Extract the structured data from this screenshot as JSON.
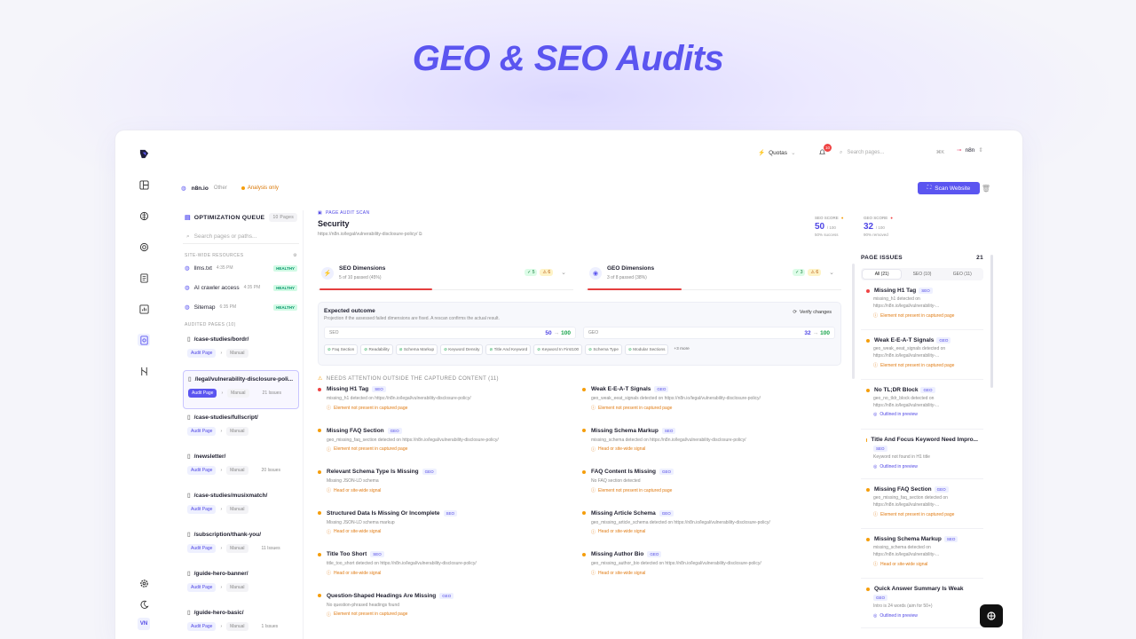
{
  "hero_title": "GEO & SEO Audits",
  "topbar": {
    "quotas": "Quotas",
    "bell_count": "10",
    "search_placeholder": "Search pages...",
    "shortcut": "⌘K",
    "user": "n8n"
  },
  "site": {
    "domain": "n8n.io",
    "category": "Other",
    "mode": "Analysis only",
    "scan_label": "Scan Website"
  },
  "rail_initials": "VN",
  "queue": {
    "title": "OPTIMIZATION QUEUE",
    "count": "10 Pages",
    "search_placeholder": "Search pages or paths...",
    "site_wide_label": "SITE-WIDE RESOURCES",
    "resources": [
      {
        "name": "llms.txt",
        "time": "4:35 PM",
        "status": "HEALTHY"
      },
      {
        "name": "AI crawler access",
        "time": "4:35 PM",
        "status": "HEALTHY"
      },
      {
        "name": "Sitemap",
        "time": "6:35 PM",
        "status": "HEALTHY"
      }
    ],
    "audited_label": "AUDITED PAGES (10)",
    "pages": [
      {
        "path": "/case-studies/bordr/",
        "audit": "Audit Page",
        "manual": "Manual",
        "issues": ""
      },
      {
        "path": "/legal/vulnerability-disclosure-poli...",
        "audit": "Audit Page",
        "manual": "Manual",
        "issues": "21 Issues"
      },
      {
        "path": "/case-studies/fullscript/",
        "audit": "Audit Page",
        "manual": "Manual",
        "issues": ""
      },
      {
        "path": "/newsletter/",
        "audit": "Audit Page",
        "manual": "Manual",
        "issues": "20 Issues"
      },
      {
        "path": "/case-studies/musixmatch/",
        "audit": "Audit Page",
        "manual": "Manual",
        "issues": ""
      },
      {
        "path": "/subscription/thank-you/",
        "audit": "Audit Page",
        "manual": "Manual",
        "issues": "11 Issues"
      },
      {
        "path": "/guide-hero-banner/",
        "audit": "Audit Page",
        "manual": "Manual",
        "issues": ""
      },
      {
        "path": "/guide-hero-basic/",
        "audit": "Audit Page",
        "manual": "Manual",
        "issues": "1 Issues"
      }
    ]
  },
  "audit": {
    "label": "PAGE AUDIT SCAN",
    "title": "Security",
    "url": "https://n8n.io/legal/vulnerability-disclosure-policy/"
  },
  "scores": [
    {
      "label": "SEO SCORE",
      "value": "50",
      "max": "/ 100",
      "sub": "50% success"
    },
    {
      "label": "GEO SCORE",
      "value": "32",
      "max": "/ 100",
      "sub": "90% removed"
    }
  ],
  "dimensions": [
    {
      "name": "SEO Dimensions",
      "passed": "5 of 10 passed (45%)",
      "green": "5",
      "yellow": "6"
    },
    {
      "name": "GEO Dimensions",
      "passed": "3 of 8 passed (38%)",
      "green": "3",
      "yellow": "6"
    }
  ],
  "expected": {
    "title": "Expected outcome",
    "subtitle": "Projection if the assessed failed dimensions are fixed. A rescan confirms the actual result.",
    "verify": "Verify changes",
    "seo": {
      "label": "SEO",
      "from": "50",
      "arrow": "→",
      "to": "100"
    },
    "geo": {
      "label": "GEO",
      "from": "32",
      "arrow": "→",
      "to": "100"
    },
    "tags": [
      "Faq Section",
      "Readability",
      "Schema Markup",
      "Keyword Density",
      "Title And Keyword",
      "Keyword In First100",
      "Schema Type",
      "Modular Sections",
      "+3 more"
    ]
  },
  "needs_attention": "NEEDS ATTENTION OUTSIDE THE CAPTURED CONTENT (11)",
  "issues": [
    {
      "title": "Missing H1 Tag",
      "badge": "SEO",
      "desc": "missing_h1 detected on https://n8n.io/legal/vulnerability-disclosure-policy/",
      "note": "Element not present in captured page",
      "color": "#ef4444"
    },
    {
      "title": "Weak E-E-A-T Signals",
      "badge": "GEO",
      "desc": "geo_weak_eeat_signals detected on https://n8n.io/legal/vulnerability-disclosure-policy/",
      "note": "Element not present in captured page",
      "color": "#f59e0b"
    },
    {
      "title": "Missing FAQ Section",
      "badge": "GEO",
      "desc": "geo_missing_faq_section detected on https://n8n.io/legal/vulnerability-disclosure-policy/",
      "note": "Element not present in captured page",
      "color": "#f59e0b"
    },
    {
      "title": "Missing Schema Markup",
      "badge": "SEO",
      "desc": "missing_schema detected on https://n8n.io/legal/vulnerability-disclosure-policy/",
      "note": "Head or site-wide signal",
      "color": "#f59e0b"
    },
    {
      "title": "Relevant Schema Type Is Missing",
      "badge": "GEO",
      "desc": "Missing JSON-LD schema",
      "note": "Head or site-wide signal",
      "color": "#f59e0b"
    },
    {
      "title": "FAQ Content Is Missing",
      "badge": "GEO",
      "desc": "No FAQ section detected",
      "note": "Element not present in captured page",
      "color": "#f59e0b"
    },
    {
      "title": "Structured Data Is Missing Or Incomplete",
      "badge": "SEO",
      "desc": "Missing JSON-LD schema markup",
      "note": "Head or site-wide signal",
      "color": "#f59e0b"
    },
    {
      "title": "Missing Article Schema",
      "badge": "GEO",
      "desc": "geo_missing_article_schema detected on https://n8n.io/legal/vulnerability-disclosure-policy/",
      "note": "Head or site-wide signal",
      "color": "#f59e0b"
    },
    {
      "title": "Title Too Short",
      "badge": "SEO",
      "desc": "title_too_short detected on https://n8n.io/legal/vulnerability-disclosure-policy/",
      "note": "Head or site-wide signal",
      "color": "#f59e0b"
    },
    {
      "title": "Missing Author Bio",
      "badge": "GEO",
      "desc": "geo_missing_author_bio detected on https://n8n.io/legal/vulnerability-disclosure-policy/",
      "note": "Head or site-wide signal",
      "color": "#f59e0b"
    },
    {
      "title": "Question-Shaped Headings Are Missing",
      "badge": "GEO",
      "desc": "No question-phrased headings found",
      "note": "Element not present in captured page",
      "color": "#f59e0b"
    }
  ],
  "page_issues": {
    "title": "PAGE ISSUES",
    "count": "21",
    "tabs": [
      "All (21)",
      "SEO (10)",
      "GEO (11)"
    ],
    "items": [
      {
        "title": "Missing H1 Tag",
        "badge": "SEO",
        "desc": "missing_h1 detected on https://n8n.io/legal/vulnerability-...",
        "note": "Element not present in captured page",
        "kind": "o",
        "color": "#ef4444"
      },
      {
        "title": "Weak E-E-A-T Signals",
        "badge": "GEO",
        "desc": "geo_weak_eeat_signals detected on https://n8n.io/legal/vulnerability-...",
        "note": "Element not present in captured page",
        "kind": "o",
        "color": "#f59e0b"
      },
      {
        "title": "No TL;DR Block",
        "badge": "GEO",
        "desc": "geo_no_tldr_block detected on https://n8n.io/legal/vulnerability-...",
        "note": "Outlined in preview",
        "kind": "b",
        "color": "#f59e0b"
      },
      {
        "title": "Title And Focus Keyword Need Impro...",
        "badge": "SEO",
        "desc": "Keyword not found in H1 title",
        "note": "Outlined in preview",
        "kind": "b",
        "color": "#f59e0b"
      },
      {
        "title": "Missing FAQ Section",
        "badge": "GEO",
        "desc": "geo_missing_faq_section detected on https://n8n.io/legal/vulnerability-...",
        "note": "Element not present in captured page",
        "kind": "o",
        "color": "#f59e0b"
      },
      {
        "title": "Missing Schema Markup",
        "badge": "SEO",
        "desc": "missing_schema detected on https://n8n.io/legal/vulnerability-...",
        "note": "Head or site-wide signal",
        "kind": "o",
        "color": "#f59e0b"
      },
      {
        "title": "Quick Answer Summary Is Weak",
        "badge": "GEO",
        "desc": "Intro is 24 words (aim for 50+)",
        "note": "Outlined in preview",
        "kind": "b",
        "color": "#f59e0b"
      }
    ]
  }
}
